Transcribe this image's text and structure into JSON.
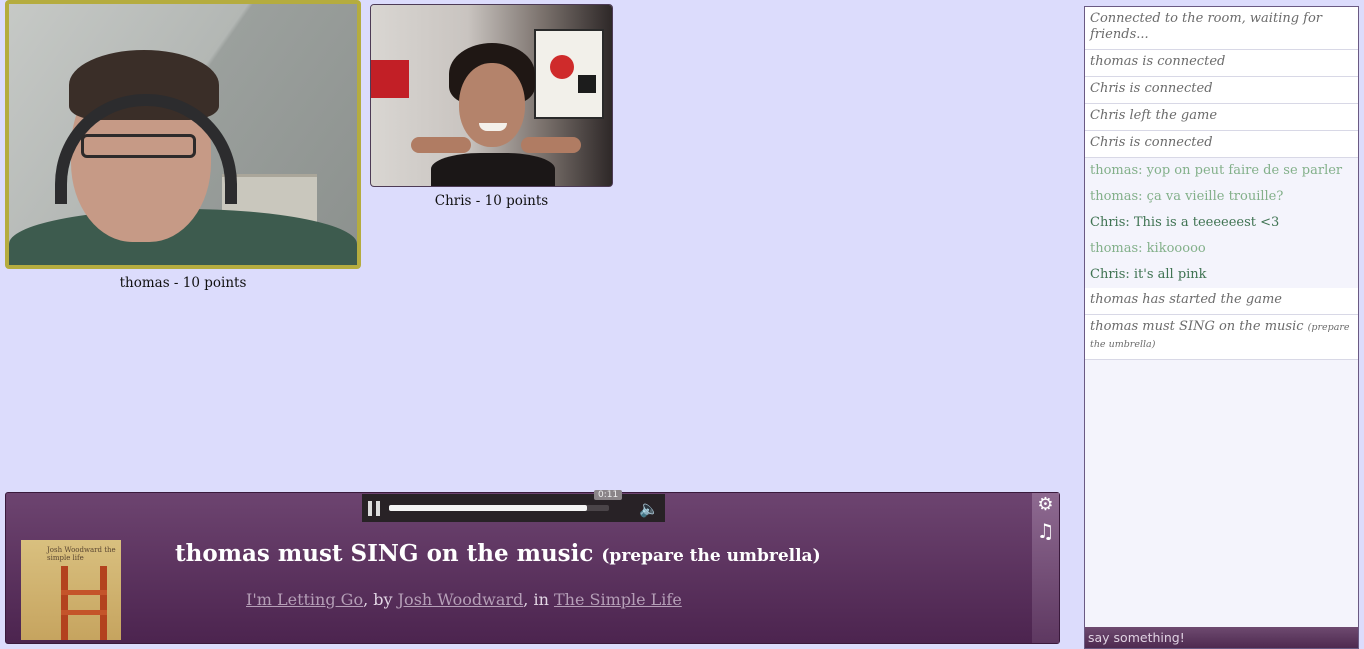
{
  "players": [
    {
      "name": "thomas",
      "caption": "thomas - 10 points",
      "active": true
    },
    {
      "name": "Chris",
      "caption": "Chris - 10 points",
      "active": false
    }
  ],
  "chat": {
    "messages": [
      {
        "type": "system",
        "text": "Connected to the room, waiting for friends..."
      },
      {
        "type": "system",
        "text": "thomas is connected"
      },
      {
        "type": "system",
        "text": "Chris is connected"
      },
      {
        "type": "system",
        "text": "Chris left the game"
      },
      {
        "type": "system",
        "text": "Chris is connected"
      },
      {
        "type": "chat-thomas",
        "text": "thomas: yop on peut faire de se parler"
      },
      {
        "type": "chat-thomas",
        "text": "thomas: ça va vieille trouille?"
      },
      {
        "type": "chat-chris",
        "text": "Chris: This is a teeeeeest <3"
      },
      {
        "type": "chat-thomas",
        "text": "thomas: kikooooo"
      },
      {
        "type": "chat-chris",
        "text": "Chris: it's all pink"
      },
      {
        "type": "system",
        "text": "thomas has started the game"
      },
      {
        "type": "system",
        "text": "thomas must SING on the music",
        "small": "(prepare the umbrella)"
      }
    ],
    "input_placeholder": "say something!"
  },
  "music": {
    "challenge_title": "thomas must SING on the music",
    "challenge_hint": "(prepare the umbrella)",
    "track": "I'm Letting Go",
    "by_label": ", by ",
    "artist": "Josh Woodward",
    "in_label": ", in ",
    "album": "The Simple Life",
    "album_cover_text": "Josh Woodward the simple life",
    "current_time": "0:11",
    "progress_fraction": 0.9
  },
  "icons": {
    "gear": "⚙",
    "music_note": "♫",
    "volume": "🔈"
  },
  "colors": {
    "background": "#dcdcfc",
    "active_player_border": "#b5ac3f",
    "music_bar": "#5c3460",
    "chat_thomas": "#83b08a",
    "chat_chris": "#3f7352"
  }
}
